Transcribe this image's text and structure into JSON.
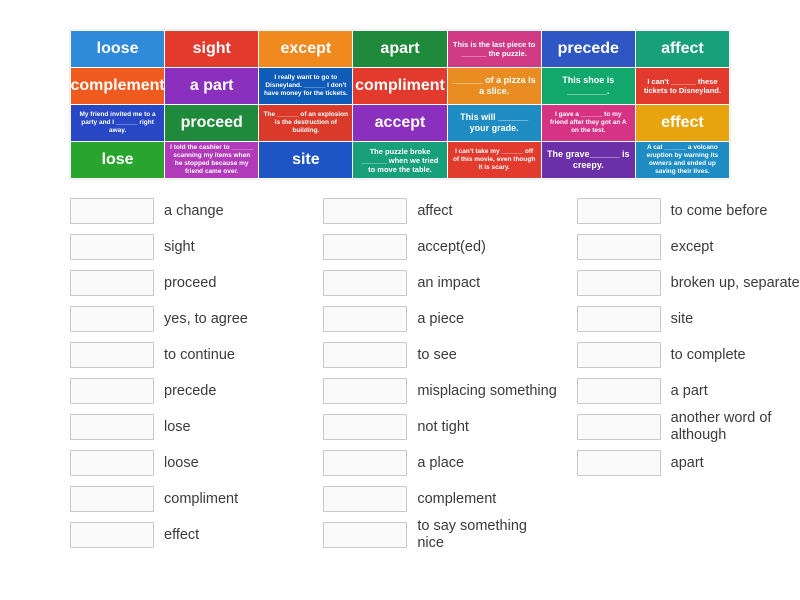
{
  "tiles": [
    {
      "text": "loose",
      "bg": "#2f8ad9",
      "cls": ""
    },
    {
      "text": "sight",
      "bg": "#e23b2e",
      "cls": ""
    },
    {
      "text": "except",
      "bg": "#f08a1f",
      "cls": ""
    },
    {
      "text": "apart",
      "bg": "#1f8a3b",
      "cls": ""
    },
    {
      "text": "This is the last piece to ______ the puzzle.",
      "bg": "#d13b86",
      "cls": "small"
    },
    {
      "text": "precede",
      "bg": "#2f57c4",
      "cls": ""
    },
    {
      "text": "affect",
      "bg": "#17a07a",
      "cls": ""
    },
    {
      "text": "complement",
      "bg": "#ef5a1e",
      "cls": ""
    },
    {
      "text": "a part",
      "bg": "#8b2fbf",
      "cls": ""
    },
    {
      "text": "I really want to go to Disneyland. ______ I don't have money for the tickets.",
      "bg": "#0f5bb8",
      "cls": "tiny"
    },
    {
      "text": "compliment",
      "bg": "#e23b2e",
      "cls": ""
    },
    {
      "text": "______ of a pizza is a slice.",
      "bg": "#e98c22",
      "cls": "med"
    },
    {
      "text": "This shoe is ________.",
      "bg": "#12a86b",
      "cls": "med"
    },
    {
      "text": "I can't ______ these tickets to Disneyland.",
      "bg": "#e23b2e",
      "cls": "small"
    },
    {
      "text": "My friend invited me to a party and I ______ right away.",
      "bg": "#2747c4",
      "cls": "tiny"
    },
    {
      "text": "proceed",
      "bg": "#1f8a3b",
      "cls": ""
    },
    {
      "text": "The ______ of an explosion is the destruction of building.",
      "bg": "#d93a2a",
      "cls": "tiny"
    },
    {
      "text": "accept",
      "bg": "#8b2fbf",
      "cls": ""
    },
    {
      "text": "This will ______ your grade.",
      "bg": "#1f8dc4",
      "cls": "med"
    },
    {
      "text": "I gave a ______ to my friend after they got an A on the test.",
      "bg": "#d63384",
      "cls": "tiny"
    },
    {
      "text": "effect",
      "bg": "#e7a40f",
      "cls": ""
    },
    {
      "text": "lose",
      "bg": "#29a52e",
      "cls": ""
    },
    {
      "text": "I told the cashier to ______ scanning my items when he stopped because my friend came over.",
      "bg": "#b03ab8",
      "cls": "tiny"
    },
    {
      "text": "site",
      "bg": "#1e54c4",
      "cls": ""
    },
    {
      "text": "The puzzle broke ______ when we tried to move the table.",
      "bg": "#17a07a",
      "cls": "small"
    },
    {
      "text": "I can't take my ______ off of this movie, even though it is scary.",
      "bg": "#e23b2e",
      "cls": "tiny"
    },
    {
      "text": "The grave______ is creepy.",
      "bg": "#6b2fa8",
      "cls": "med"
    },
    {
      "text": "A cat ______ a volcano eruption by warning its owners and ended up saving their lives.",
      "bg": "#1f8dc4",
      "cls": "tiny"
    }
  ],
  "answers_col1": [
    "a change",
    "sight",
    "proceed",
    "yes, to agree",
    "to continue",
    "precede",
    "lose",
    "loose",
    "compliment",
    "effect"
  ],
  "answers_col2": [
    "affect",
    "accept(ed)",
    "an impact",
    "a piece",
    "to see",
    "misplacing something",
    "not tight",
    "a place",
    "complement",
    "to say something nice"
  ],
  "answers_col3": [
    "to come before",
    "except",
    "broken up, separated",
    "site",
    "to complete",
    "a part",
    "another word of although",
    "apart"
  ]
}
